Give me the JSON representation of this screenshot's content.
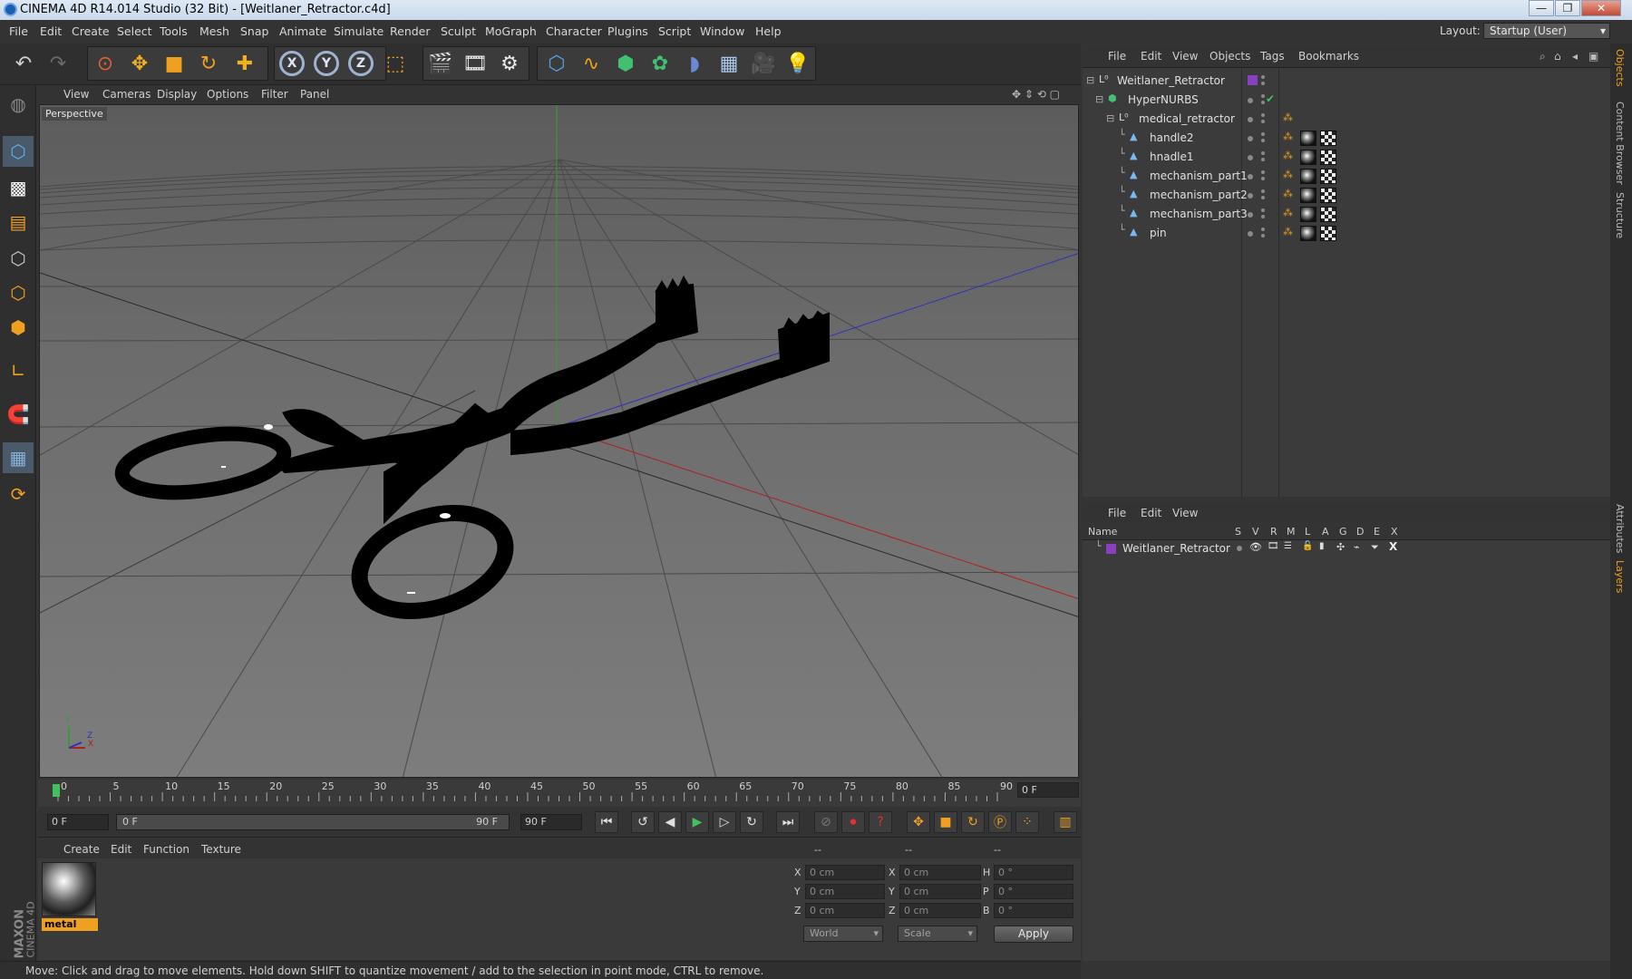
{
  "window": {
    "title": "CINEMA 4D R14.014 Studio (32 Bit) - [Weitlaner_Retractor.c4d]",
    "minimize": "—",
    "maximize": "❐",
    "close": "✕"
  },
  "menubar": {
    "items": [
      "File",
      "Edit",
      "Create",
      "Select",
      "Tools",
      "Mesh",
      "Snap",
      "Animate",
      "Simulate",
      "Render",
      "Sculpt",
      "MoGraph",
      "Character",
      "Plugins",
      "Script",
      "Window",
      "Help"
    ],
    "layout_label": "Layout:",
    "layout_value": "Startup (User)"
  },
  "toolbar": {
    "axis_x": "X",
    "axis_y": "Y",
    "axis_z": "Z"
  },
  "viewport": {
    "menu": [
      "View",
      "Cameras",
      "Display",
      "Options",
      "Filter",
      "Panel"
    ],
    "camera_label": "Perspective",
    "axis_y": "Y",
    "axis_x": "X",
    "axis_z": "Z"
  },
  "timeline": {
    "ticks": [
      "0",
      "5",
      "10",
      "15",
      "20",
      "25",
      "30",
      "35",
      "40",
      "45",
      "50",
      "55",
      "60",
      "65",
      "70",
      "75",
      "80",
      "85",
      "90"
    ],
    "current_frame": "0 F"
  },
  "playback": {
    "start_field": "0 F",
    "range_start": "0 F",
    "range_end": "90 F",
    "end_field": "90 F"
  },
  "material_manager": {
    "menu": [
      "Create",
      "Edit",
      "Function",
      "Texture"
    ],
    "material_name": "metal"
  },
  "brand": {
    "maxon": "MAXON",
    "product": "CINEMA 4D"
  },
  "coordinates": {
    "headers": [
      "--",
      "--",
      "--"
    ],
    "rows": [
      {
        "l1": "X",
        "v1": "0 cm",
        "l2": "X",
        "v2": "0 cm",
        "l3": "H",
        "v3": "0 °"
      },
      {
        "l1": "Y",
        "v1": "0 cm",
        "l2": "Y",
        "v2": "0 cm",
        "l3": "P",
        "v3": "0 °"
      },
      {
        "l1": "Z",
        "v1": "0 cm",
        "l2": "Z",
        "v2": "0 cm",
        "l3": "B",
        "v3": "0 °"
      }
    ],
    "mode": "World",
    "scale": "Scale",
    "apply": "Apply"
  },
  "status": {
    "text": "Move: Click and drag to move elements. Hold down SHIFT to quantize movement / add to the selection in point mode, CTRL to remove."
  },
  "object_manager": {
    "menu": [
      "File",
      "Edit",
      "View",
      "Objects",
      "Tags",
      "Bookmarks"
    ],
    "objects": [
      {
        "name": "Weitlaner_Retractor",
        "level": 0
      },
      {
        "name": "HyperNURBS",
        "level": 1
      },
      {
        "name": "medical_retractor",
        "level": 2
      },
      {
        "name": "handle2",
        "level": 3
      },
      {
        "name": "hnadle1",
        "level": 3
      },
      {
        "name": "mechanism_part1",
        "level": 3
      },
      {
        "name": "mechanism_part2",
        "level": 3
      },
      {
        "name": "mechanism_part3",
        "level": 3
      },
      {
        "name": "pin",
        "level": 3
      }
    ]
  },
  "layer_manager": {
    "menu": [
      "File",
      "Edit",
      "View"
    ],
    "columns": [
      "Name",
      "S",
      "V",
      "R",
      "M",
      "L",
      "A",
      "G",
      "D",
      "E",
      "X"
    ],
    "layers": [
      {
        "name": "Weitlaner_Retractor",
        "color": "#8a3fc0"
      }
    ]
  },
  "right_tabs": [
    "Objects",
    "Content Browser",
    "Structure",
    "Attributes",
    "Layers"
  ],
  "colors": {
    "accent_orange": "#f0a020",
    "axis_green": "#3a9a3a",
    "axis_blue": "#3030c0",
    "axis_red": "#b02020"
  }
}
